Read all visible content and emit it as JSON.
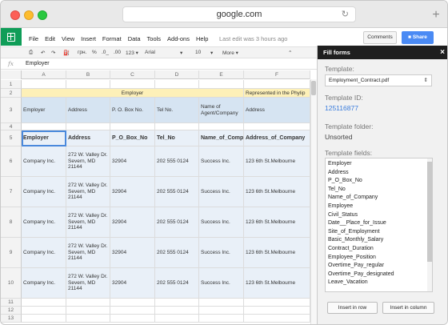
{
  "browser": {
    "url": "google.com"
  },
  "app": {
    "menu": [
      "File",
      "Edit",
      "View",
      "Insert",
      "Format",
      "Data",
      "Tools",
      "Add-ons",
      "Help"
    ],
    "last_edit": "Last edit was 3 hours ago",
    "comments_label": "Comments",
    "share_label": "Share"
  },
  "toolbar": {
    "print": "⎙",
    "undo": "↶",
    "redo": "↷",
    "paint": "🖌",
    "currency": "грн.",
    "percent": "%",
    "dec_dec": ".0_",
    "dec_inc": ".00",
    "format_123": "123 ▾",
    "font": "Arial",
    "font_arrow": "▾",
    "size": "10",
    "size_arrow": "▾",
    "more": "More ▾",
    "collapse": "⌃"
  },
  "formula_bar": {
    "fx": "fx",
    "value": "Employer"
  },
  "columns": [
    "A",
    "B",
    "C",
    "D",
    "E",
    "F"
  ],
  "rows": {
    "numbers": [
      "1",
      "2",
      "3",
      "4",
      "5",
      "6",
      "7",
      "8",
      "9",
      "10",
      "11",
      "12",
      "13"
    ],
    "row2_employer": "Employer",
    "row2_represented": "Represented in the Phylip",
    "row3": [
      "Employer",
      "Address",
      "P. O. Box No.",
      "Tel No.",
      "Name of Agent/Company",
      "Address"
    ],
    "row5": [
      "Employer",
      "Address",
      "P_O_Box_No",
      "Tel_No",
      "Name_of_Company",
      "Address_of_Company"
    ],
    "data_row": {
      "employer": "Company Inc.",
      "address": "272 W. Valley Dr. Severn, MD 21144",
      "pobox": "32904",
      "tel": "202 555 0124",
      "agent": "Success Inc.",
      "agent_address": "123 6th St.Melbourne"
    }
  },
  "panel": {
    "title": "Fill forms",
    "close": "×",
    "template_label": "Template:",
    "template_value": "Employment_Contract.pdf",
    "template_id_label": "Template ID:",
    "template_id": "125116877",
    "folder_label": "Template folder:",
    "folder_value": "Unsorted",
    "fields_label": "Template fields:",
    "fields": [
      "Employer",
      "Address",
      "P_O_Box_No",
      "Tel_No",
      "Name_of_Company",
      "Employee",
      "Civil_Status",
      "Date__Place_for_Issue",
      "Site_of_Employment",
      "Basic_Monthly_Salary",
      "Contract_Duration",
      "Employee_Position",
      "Overtime_Pay_regular",
      "Overtime_Pay_designated",
      "Leave_Vacation"
    ],
    "insert_row": "Insert in row",
    "insert_column": "Insert in column"
  }
}
